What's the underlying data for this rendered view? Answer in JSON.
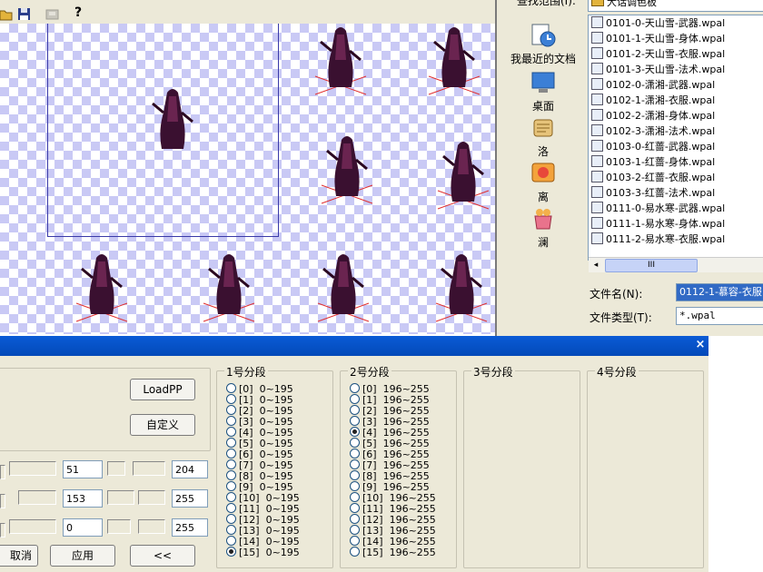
{
  "toolbar": {
    "icons": [
      "open-folder-icon",
      "save-icon",
      "disabled-tool-icon",
      "help-icon"
    ],
    "help_label": "?"
  },
  "dialog": {
    "lookin_label": "查找范围(I):",
    "lookin_value": "大话调色板",
    "places": [
      "我最近的文档",
      "桌面",
      "洛",
      "离",
      "澜"
    ],
    "files": [
      "0101-0-天山雪-武器.wpal",
      "0101-1-天山雪-身体.wpal",
      "0101-2-天山雪-衣服.wpal",
      "0101-3-天山雪-法术.wpal",
      "0102-0-潇湘-武器.wpal",
      "0102-1-潇湘-衣服.wpal",
      "0102-2-潇湘-身体.wpal",
      "0102-3-潇湘-法术.wpal",
      "0103-0-红蔷-武器.wpal",
      "0103-1-红蔷-身体.wpal",
      "0103-2-红蔷-衣服.wpal",
      "0103-3-红蔷-法术.wpal",
      "0111-0-易水寒-武器.wpal",
      "0111-1-易水寒-身体.wpal",
      "0111-2-易水寒-衣服.wpal"
    ],
    "scroll_grip": "III",
    "filename_label": "文件名(N):",
    "filename_value": "0112-1-慕容-衣服",
    "filetype_label": "文件类型(T):",
    "filetype_value": "*.wpal"
  },
  "palette": {
    "close_label": "×",
    "loadpp_label": "LoadPP",
    "custom_label": "自定义",
    "cancel_label": "取消",
    "apply_label": "应用",
    "back_label": "<<",
    "values": {
      "r1_left": "51",
      "r1_right": "204",
      "r2_left": "153",
      "r2_right": "255",
      "r3_left": "0",
      "r3_right": "255"
    },
    "groups": [
      {
        "title": "1号分段",
        "range": "0~195",
        "selected": 15
      },
      {
        "title": "2号分段",
        "range": "196~255",
        "selected": 4
      },
      {
        "title": "3号分段"
      },
      {
        "title": "4号分段"
      }
    ],
    "accent": "#0349b8"
  }
}
